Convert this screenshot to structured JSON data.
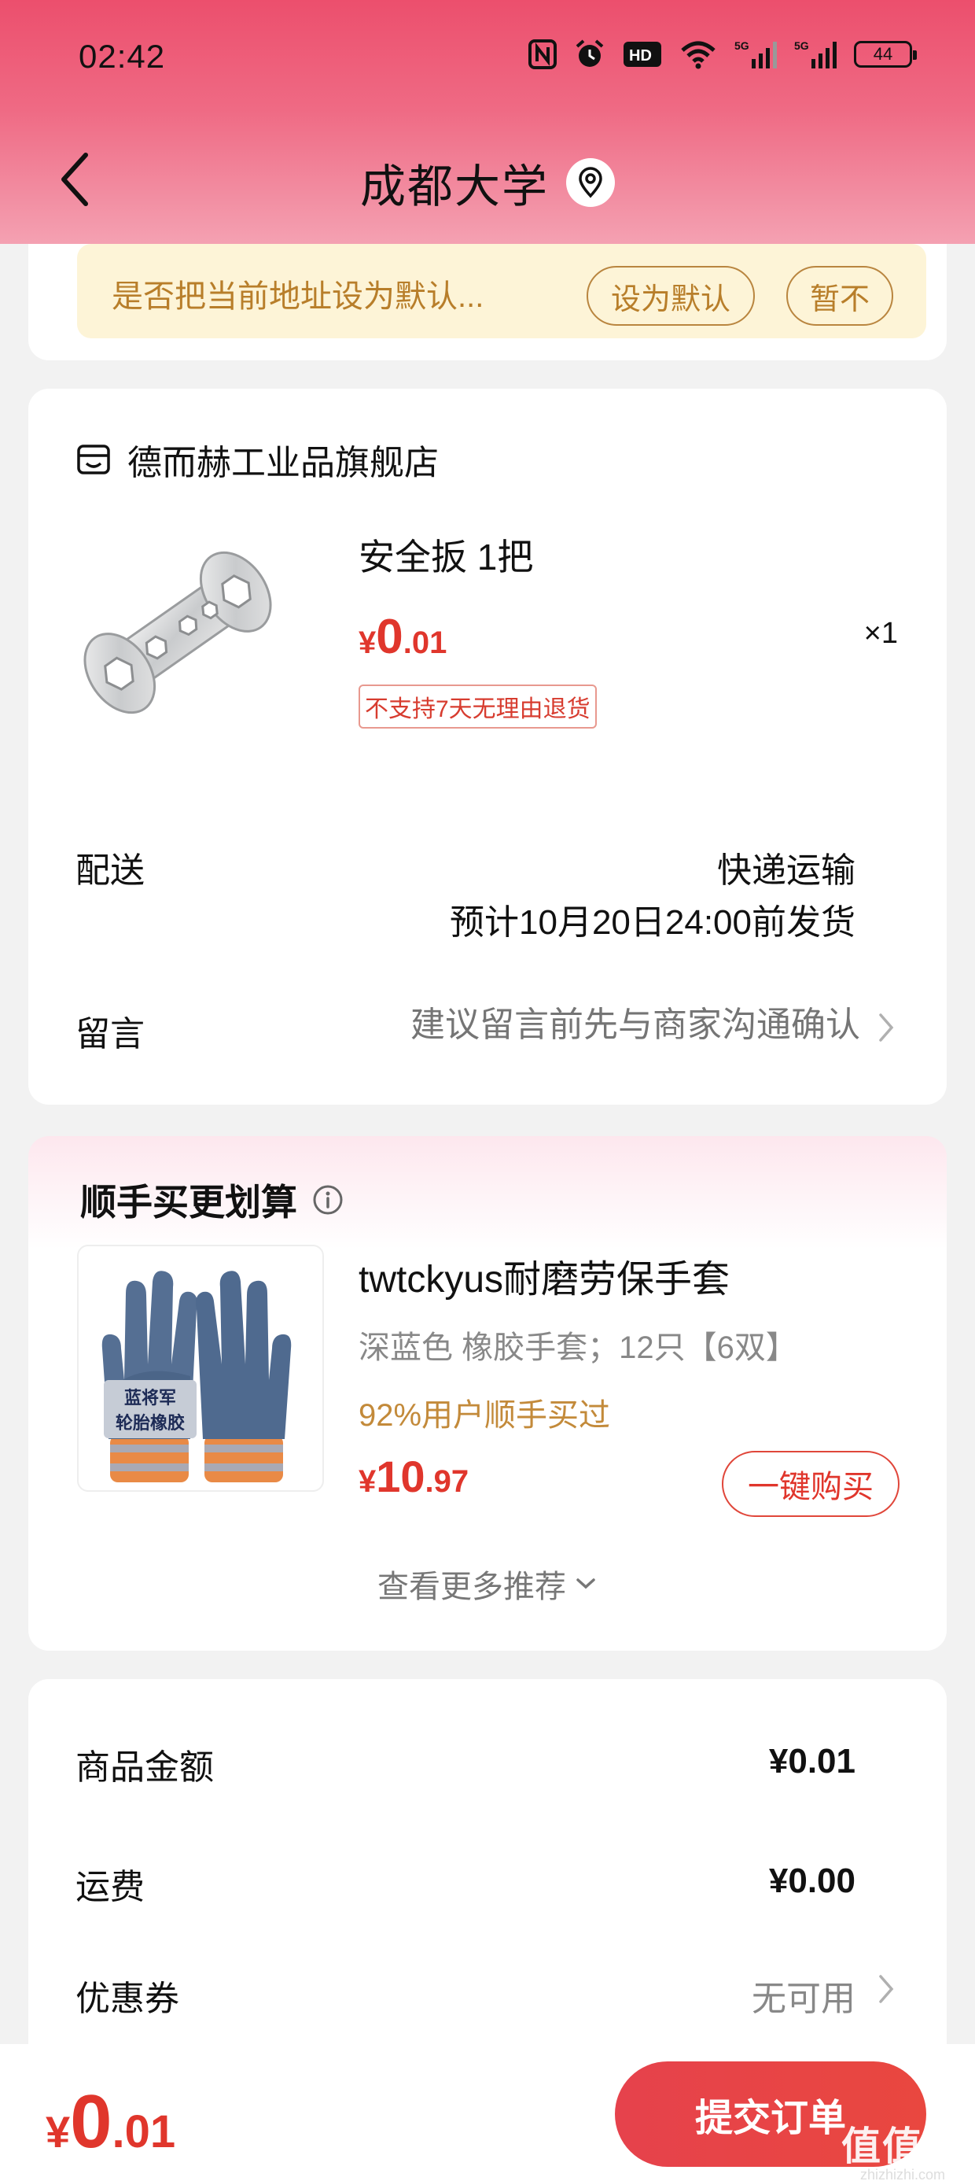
{
  "status_bar": {
    "time": "02:42",
    "battery": "44",
    "hd_label": "HD",
    "signal_label": "5G"
  },
  "nav": {
    "title": "成都大学",
    "back_icon": "chevron-left-icon",
    "location_icon": "location-pin-icon"
  },
  "address_banner": {
    "text": "是否把当前地址设为默认...",
    "set_default_label": "设为默认",
    "not_now_label": "暂不"
  },
  "order": {
    "shop_name": "德而赫工业品旗舰店",
    "shop_icon": "store-icon",
    "product": {
      "title": "安全扳 1把",
      "price_symbol": "¥",
      "price_int": "0",
      "price_dec": ".01",
      "quantity": "×1",
      "return_policy": "不支持7天无理由退货"
    },
    "delivery_label": "配送",
    "delivery_method": "快递运输",
    "delivery_eta": "预计10月20日24:00前发货",
    "note_label": "留言",
    "note_placeholder": "建议留言前先与商家沟通确认"
  },
  "recommend": {
    "title": "顺手买更划算",
    "info_icon": "info-icon",
    "item": {
      "name": "twtckyus耐磨劳保手套",
      "spec": "深蓝色   橡胶手套；12只【6双】",
      "social_proof": "92%用户顺手买过",
      "price_symbol": "¥",
      "price_int": "10",
      "price_dec": ".97",
      "buy_label": "一键购买",
      "image_caption_line1": "蓝将军",
      "image_caption_line2": "轮胎橡胶"
    },
    "more_label": "查看更多推荐"
  },
  "summary": {
    "goods_label": "商品金额",
    "goods_value": "¥0.01",
    "shipping_label": "运费",
    "shipping_value": "¥0.00",
    "coupon_label": "优惠券",
    "coupon_value": "无可用"
  },
  "bottom_bar": {
    "total_symbol": "¥",
    "total_int": "0",
    "total_dec": ".01",
    "submit_label": "提交订单"
  },
  "watermark": {
    "logo": "值值值",
    "url": "zhizhizhi.com"
  },
  "colors": {
    "accent_red": "#e0362c",
    "header_pink": "#ec4f6d",
    "banner_bg": "#fdf4d7",
    "banner_text": "#b87e2a"
  }
}
